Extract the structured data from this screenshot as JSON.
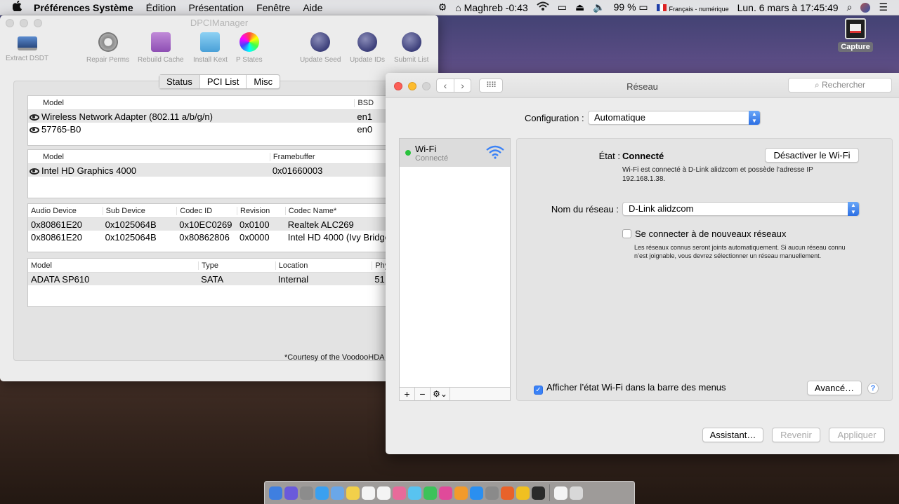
{
  "menubar": {
    "apple_icon": "apple-icon",
    "app_name": "Préférences Système",
    "menus": [
      "Édition",
      "Présentation",
      "Fenêtre",
      "Aide"
    ],
    "clock_zone": "Maghreb -0:43",
    "battery": "99 %",
    "input_source": "Français - numérique",
    "datetime": "Lun. 6 mars à  17:45:49"
  },
  "desktop": {
    "capture_label": "Capture"
  },
  "dpci": {
    "title": "DPCIManager",
    "toolbar": [
      "Extract DSDT",
      "Repair Perms",
      "Rebuild Cache",
      "Install Kext",
      "P States",
      "Update Seed",
      "Update IDs",
      "Submit List"
    ],
    "tabs": [
      "Status",
      "PCI List",
      "Misc"
    ],
    "network_table": {
      "headers": [
        "Model",
        "BSD"
      ],
      "rows": [
        [
          "Wireless Network Adapter (802.11 a/b/g/n)",
          "en1"
        ],
        [
          "57765-B0",
          "en0"
        ]
      ]
    },
    "graphics_table": {
      "headers": [
        "Model",
        "Framebuffer"
      ],
      "rows": [
        [
          "Intel HD Graphics 4000",
          "0x01660003"
        ]
      ]
    },
    "audio_table": {
      "headers": [
        "Audio Device",
        "Sub Device",
        "Codec ID",
        "Revision",
        "Codec Name*"
      ],
      "rows": [
        [
          "0x80861E20",
          "0x1025064B",
          "0x10EC0269",
          "0x0100",
          "Realtek ALC269"
        ],
        [
          "0x80861E20",
          "0x1025064B",
          "0x80862806",
          "0x0000",
          "Intel HD 4000 (Ivy Bridge)"
        ]
      ]
    },
    "storage_table": {
      "headers": [
        "Model",
        "Type",
        "Location",
        "Phy"
      ],
      "rows": [
        [
          "ADATA SP610",
          "SATA",
          "Internal",
          "51"
        ]
      ]
    },
    "courtesy": "*Courtesy of the VoodooHDA"
  },
  "network": {
    "title": "Réseau",
    "search_placeholder": "Rechercher",
    "configuration_label": "Configuration :",
    "configuration_value": "Automatique",
    "services": [
      {
        "name": "Wi-Fi",
        "status": "Connecté"
      }
    ],
    "state_label": "État :",
    "state_value": "Connecté",
    "disable_wifi_button": "Désactiver le Wi-Fi",
    "state_description": "Wi-Fi est connecté à D-Link alidzcom et possède l’adresse IP 192.168.1.38.",
    "network_name_label": "Nom du réseau :",
    "network_name_value": "D-Link alidzcom",
    "ask_join_label": "Se connecter à de nouveaux réseaux",
    "ask_join_description": "Les réseaux connus seront joints automatiquement. Si aucun réseau connu n’est joignable, vous devrez sélectionner un réseau manuellement.",
    "show_status_label": "Afficher l’état Wi-Fi dans la barre des menus",
    "advanced_button": "Avancé…",
    "assistant_button": "Assistant…",
    "revert_button": "Revenir",
    "apply_button": "Appliquer",
    "colors": {
      "connected": "#29c23c",
      "accent": "#3b82f6"
    }
  },
  "dock": {
    "icons": [
      "finder-icon",
      "siri-icon",
      "launchpad-icon",
      "safari-icon",
      "mail-icon",
      "notes-icon",
      "calendar-icon",
      "reminders-icon",
      "photos-icon",
      "messages-icon",
      "facetime-icon",
      "itunes-icon",
      "ibooks-icon",
      "app-store-icon",
      "system-preferences-icon",
      "firefox-icon",
      "wifi-app-icon",
      "activity-monitor-icon",
      "document-icon",
      "trash-icon"
    ],
    "colors": [
      "#3f7fe0",
      "#6a5adb",
      "#8c8c8c",
      "#3aa0f0",
      "#6aa7e8",
      "#f2d04a",
      "#f4f4f4",
      "#f4f4f4",
      "#e86a9a",
      "#58c3f0",
      "#3cc25a",
      "#e04a9a",
      "#f29a2a",
      "#2a8ff0",
      "#8a8a8a",
      "#e8622a",
      "#f0c020",
      "#2a2a2a",
      "#f4f4f4",
      "#d8d8d8"
    ]
  }
}
